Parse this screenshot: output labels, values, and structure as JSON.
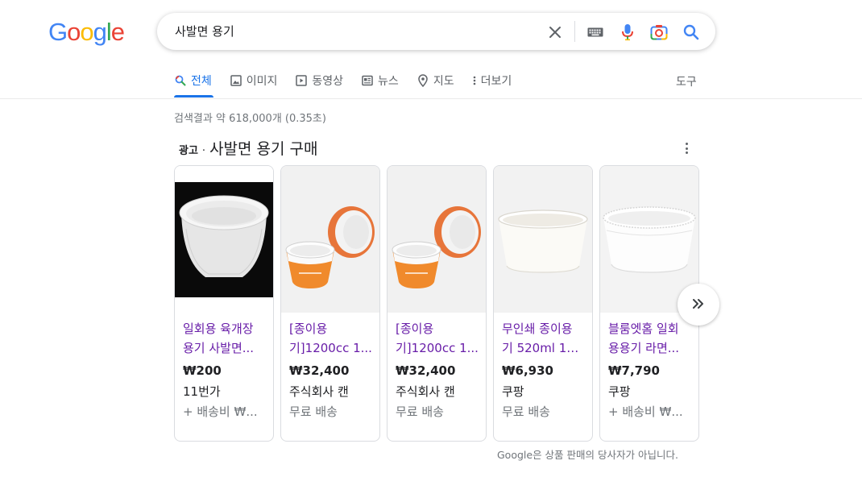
{
  "logo": {
    "letters": [
      "G",
      "o",
      "o",
      "g",
      "l",
      "e"
    ],
    "colors": [
      "#4285f4",
      "#ea4335",
      "#fbbc05",
      "#4285f4",
      "#34a853",
      "#ea4335"
    ]
  },
  "search": {
    "query": "사발면 용기"
  },
  "nav": {
    "tabs": [
      {
        "label": "전체",
        "icon": "search-icon",
        "active": true
      },
      {
        "label": "이미지",
        "icon": "image-icon"
      },
      {
        "label": "동영상",
        "icon": "video-icon"
      },
      {
        "label": "뉴스",
        "icon": "news-icon"
      },
      {
        "label": "지도",
        "icon": "map-pin-icon"
      },
      {
        "label": "더보기",
        "icon": "more-vert-icon"
      }
    ],
    "tools_label": "도구"
  },
  "stats": "검색결과 약 618,000개 (0.35초)",
  "ads": {
    "tag": "광고",
    "separator": "·",
    "title": "사발면 용기 구매",
    "products": [
      {
        "title_line1": "일회용 육개장",
        "title_line2": "용기 사발면...",
        "price": "₩200",
        "seller": "11번가",
        "shipping": "+ 배송비 ₩..."
      },
      {
        "title_line1": "[종이용",
        "title_line2": "기]1200cc 1...",
        "price": "₩32,400",
        "seller": "주식회사 캔",
        "shipping": "무료 배송"
      },
      {
        "title_line1": "[종이용",
        "title_line2": "기]1200cc 1...",
        "price": "₩32,400",
        "seller": "주식회사 캔",
        "shipping": "무료 배송"
      },
      {
        "title_line1": "무인쇄 종이용",
        "title_line2": "기 520ml 10...",
        "price": "₩6,930",
        "seller": "쿠팡",
        "shipping": "무료 배송"
      },
      {
        "title_line1": "블룸엣홈 일회",
        "title_line2": "용용기 라면...",
        "price": "₩7,790",
        "seller": "쿠팡",
        "shipping": "+ 배송비 ₩..."
      }
    ],
    "disclaimer": "Google은 상품 판매의 당사자가 아닙니다."
  },
  "colors": {
    "accent": "#1a73e8",
    "visited_link": "#681da8",
    "muted": "#70757a"
  }
}
